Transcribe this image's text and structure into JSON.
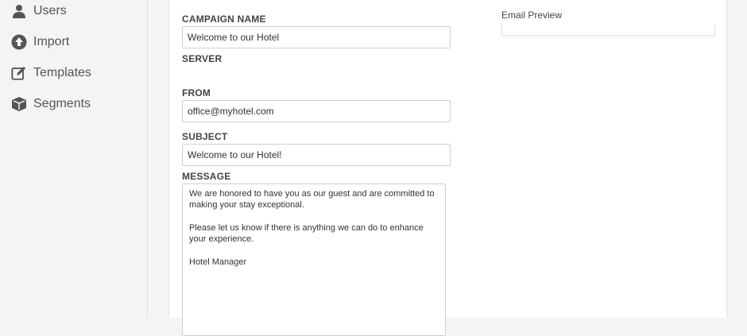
{
  "sidebar": {
    "items": [
      {
        "label": "Users",
        "icon": "user-icon"
      },
      {
        "label": "Import",
        "icon": "upload-circle-icon"
      },
      {
        "label": "Templates",
        "icon": "edit-icon"
      },
      {
        "label": "Segments",
        "icon": "cube-icon"
      }
    ]
  },
  "form": {
    "campaign_name_label": "CAMPAIGN NAME",
    "campaign_name_value": "Welcome to our Hotel",
    "server_label": "SERVER",
    "from_label": "FROM",
    "from_value": "office@myhotel.com",
    "subject_label": "SUBJECT",
    "subject_value": "Welcome to our Hotel!",
    "message_label": "MESSAGE",
    "message_paragraphs": [
      "We are honored to have you as our guest and are committed to making your stay exceptional.",
      "Please let us know if there is anything we can do to enhance your experience.",
      "Hotel Manager"
    ]
  },
  "preview": {
    "title": "Email Preview"
  },
  "colors": {
    "icon": "#555555",
    "label": "#444444",
    "sidebar_bg": "#f4f4f4"
  }
}
